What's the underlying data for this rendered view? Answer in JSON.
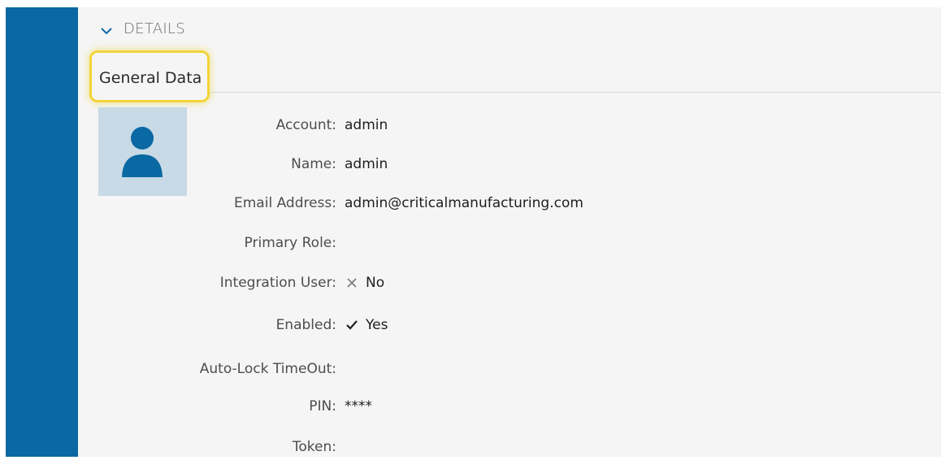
{
  "details": {
    "title": "DETAILS"
  },
  "tabs": [
    {
      "label": "General Data",
      "selected": true
    }
  ],
  "fields": [
    {
      "label": "Account:",
      "value": "admin"
    },
    {
      "label": "Name:",
      "value": "admin"
    },
    {
      "label": "Email Address:",
      "value": "admin@criticalmanufacturing.com"
    },
    {
      "label": "Primary Role:",
      "value": ""
    },
    {
      "label": "Integration User:",
      "value": "No",
      "icon": "cross-icon"
    },
    {
      "label": "Enabled:",
      "value": "Yes",
      "icon": "check-icon"
    },
    {
      "label": "Auto-Lock TimeOut:",
      "value": ""
    },
    {
      "label": "PIN:",
      "value": "****"
    },
    {
      "label": "Token:",
      "value": ""
    }
  ],
  "avatar": {
    "icon": "user-icon"
  },
  "colors": {
    "sidebar": "#0a68a2",
    "avatar_bg": "#c7dae6",
    "avatar_fg": "#0a68a2",
    "tab_highlight": "#f2d43a"
  }
}
